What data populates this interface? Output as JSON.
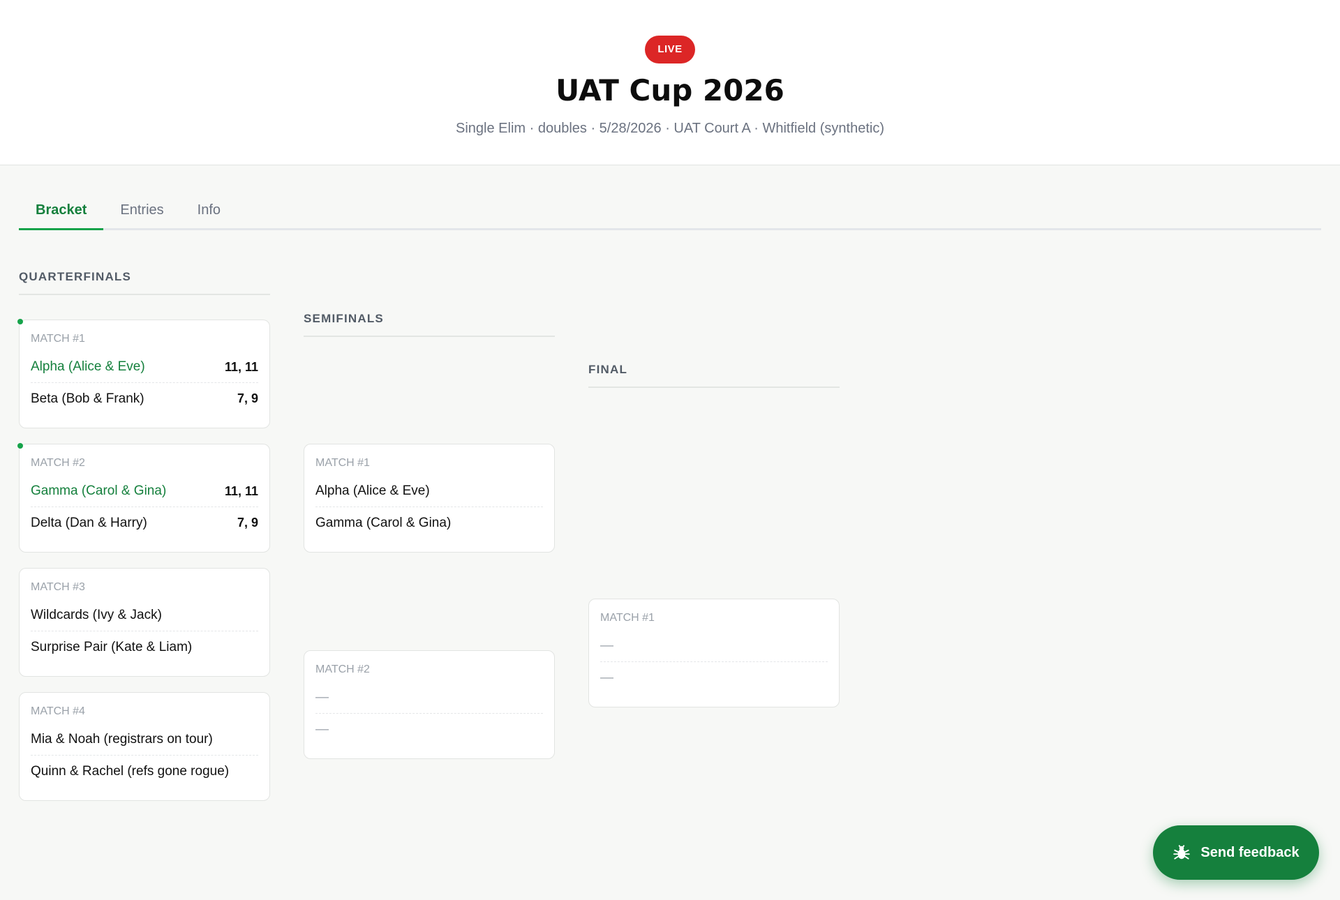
{
  "header": {
    "badge": "LIVE",
    "title": "UAT Cup 2026",
    "subtitle": "Single Elim · doubles · 5/28/2026 · UAT Court A · Whitfield (synthetic)"
  },
  "tabs": [
    {
      "label": "Bracket",
      "active": true
    },
    {
      "label": "Entries",
      "active": false
    },
    {
      "label": "Info",
      "active": false
    }
  ],
  "rounds": {
    "quarterfinals": {
      "title": "QUARTERFINALS",
      "matches": [
        {
          "label": "MATCH #1",
          "live": true,
          "team1": {
            "name": "Alpha (Alice & Eve)",
            "score": "11, 11",
            "winner": true
          },
          "team2": {
            "name": "Beta (Bob & Frank)",
            "score": "7, 9",
            "winner": false
          }
        },
        {
          "label": "MATCH #2",
          "live": true,
          "team1": {
            "name": "Gamma (Carol & Gina)",
            "score": "11, 11",
            "winner": true
          },
          "team2": {
            "name": "Delta (Dan & Harry)",
            "score": "7, 9",
            "winner": false
          }
        },
        {
          "label": "MATCH #3",
          "live": false,
          "team1": {
            "name": "Wildcards (Ivy & Jack)",
            "score": "",
            "winner": false
          },
          "team2": {
            "name": "Surprise Pair (Kate & Liam)",
            "score": "",
            "winner": false
          }
        },
        {
          "label": "MATCH #4",
          "live": false,
          "team1": {
            "name": "Mia & Noah (registrars on tour)",
            "score": "",
            "winner": false
          },
          "team2": {
            "name": "Quinn & Rachel (refs gone rogue)",
            "score": "",
            "winner": false
          }
        }
      ]
    },
    "semifinals": {
      "title": "SEMIFINALS",
      "matches": [
        {
          "label": "MATCH #1",
          "team1": {
            "name": "Alpha (Alice & Eve)",
            "score": ""
          },
          "team2": {
            "name": "Gamma (Carol & Gina)",
            "score": ""
          }
        },
        {
          "label": "MATCH #2",
          "team1": {
            "name": "—",
            "score": ""
          },
          "team2": {
            "name": "—",
            "score": ""
          }
        }
      ]
    },
    "final": {
      "title": "FINAL",
      "matches": [
        {
          "label": "MATCH #1",
          "team1": {
            "name": "—",
            "score": ""
          },
          "team2": {
            "name": "—",
            "score": ""
          }
        }
      ]
    }
  },
  "feedback": {
    "label": "Send feedback",
    "icon": "bug-icon"
  },
  "colors": {
    "accent": "#15803d",
    "live": "#dc2626"
  }
}
